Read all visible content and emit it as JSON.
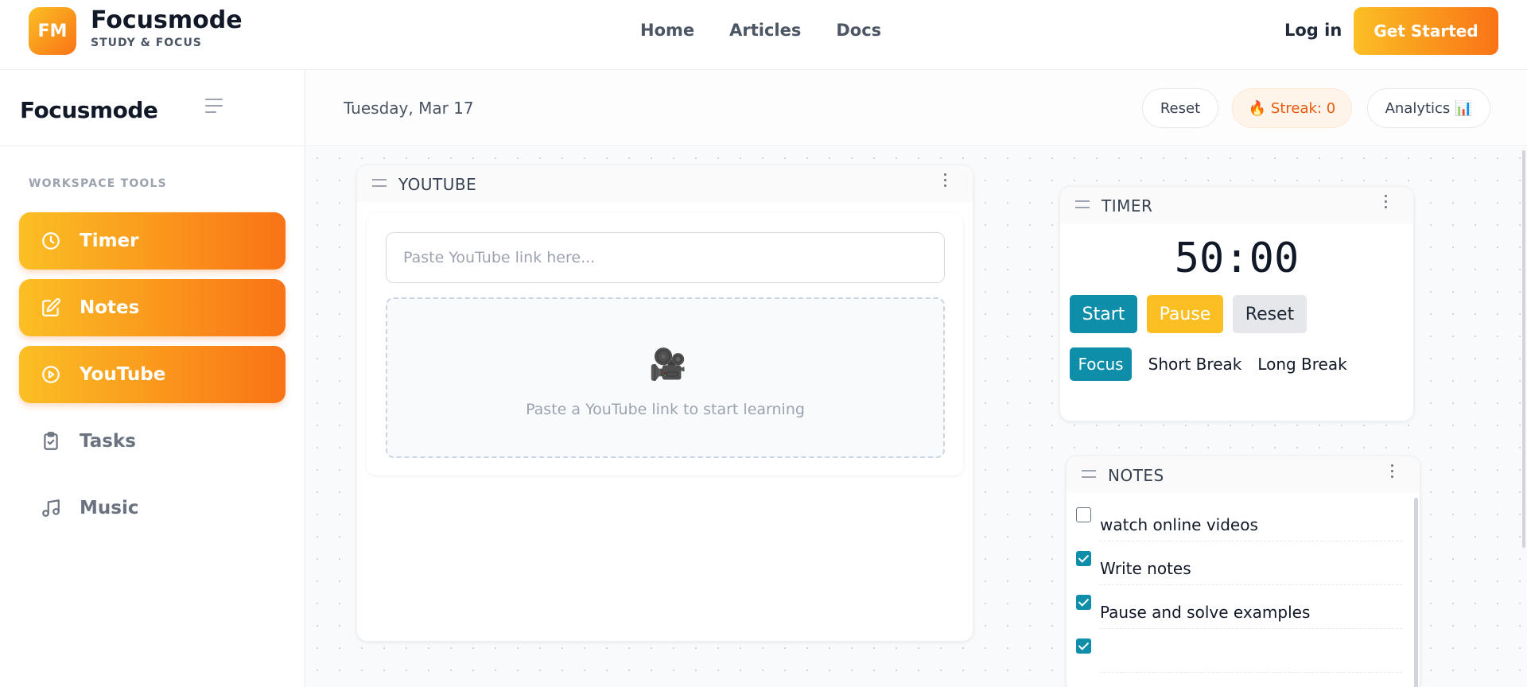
{
  "topnav": {
    "logo": "FM",
    "brand": "Focusmode",
    "tagline": "STUDY & FOCUS",
    "links": [
      "Home",
      "Articles",
      "Docs"
    ],
    "login": "Log in",
    "cta": "Get Started"
  },
  "sidebar": {
    "title": "Focusmode",
    "section": "WORKSPACE TOOLS",
    "items": [
      {
        "label": "Timer",
        "icon": "clock-icon",
        "active": true
      },
      {
        "label": "Notes",
        "icon": "edit-icon",
        "active": true
      },
      {
        "label": "YouTube",
        "icon": "play-circle-icon",
        "active": true
      },
      {
        "label": "Tasks",
        "icon": "clipboard-check-icon",
        "active": false
      },
      {
        "label": "Music",
        "icon": "music-note-icon",
        "active": false
      }
    ]
  },
  "header": {
    "date": "Tuesday, Mar 17",
    "reset": "Reset",
    "streak": "🔥 Streak: 0",
    "analytics": "Analytics 📊"
  },
  "youtube": {
    "title": "YOUTUBE",
    "placeholder": "Paste YouTube link here...",
    "icon": "🎥",
    "hint": "Paste a YouTube link to start learning"
  },
  "timer": {
    "title": "TIMER",
    "time": "50:00",
    "start": "Start",
    "pause": "Pause",
    "reset": "Reset",
    "modes": [
      "Focus",
      "Short Break",
      "Long Break"
    ],
    "active_mode": "Focus"
  },
  "notes": {
    "title": "NOTES",
    "items": [
      {
        "text": "watch online videos",
        "checked": false
      },
      {
        "text": "Write notes",
        "checked": true
      },
      {
        "text": "Pause and solve examples",
        "checked": true
      },
      {
        "text": "",
        "checked": true
      }
    ]
  },
  "colors": {
    "accent_start": "#fbbf24",
    "accent_end": "#f97316",
    "teal": "#0e8ea9"
  }
}
